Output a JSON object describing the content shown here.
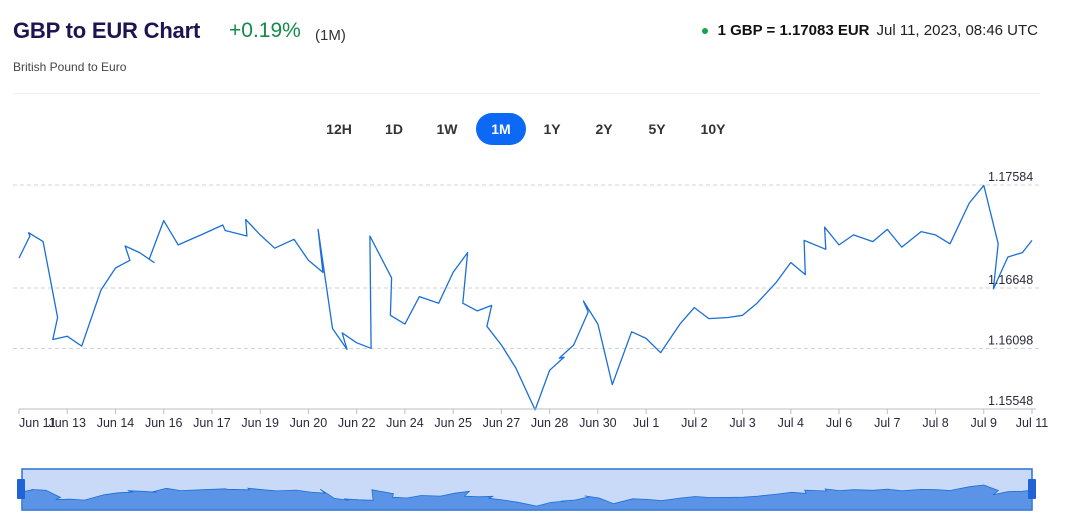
{
  "header": {
    "title": "GBP to EUR Chart",
    "change": "+0.19%",
    "period": "(1M)",
    "subtitle": "British Pound to Euro",
    "rate": "1 GBP = 1.17083 EUR",
    "timestamp": "Jul 11, 2023, 08:46 UTC"
  },
  "periods": {
    "buttons": [
      "12H",
      "1D",
      "1W",
      "1M",
      "1Y",
      "2Y",
      "5Y",
      "10Y"
    ],
    "active": "1M"
  },
  "colors": {
    "line": "#1b6fd6",
    "accent": "#0b69f6",
    "positive": "#138a4a",
    "navigator_fill": "#5b93e6",
    "navigator_bg": "#c8daf7"
  },
  "chart_data": {
    "type": "line",
    "x_tick_labels": [
      "Jun 11",
      "Jun 13",
      "Jun 14",
      "Jun 16",
      "Jun 17",
      "Jun 19",
      "Jun 20",
      "Jun 22",
      "Jun 24",
      "Jun 25",
      "Jun 27",
      "Jun 28",
      "Jun 30",
      "Jul 1",
      "Jul 2",
      "Jul 3",
      "Jul 4",
      "Jul 6",
      "Jul 7",
      "Jul 8",
      "Jul 9",
      "Jul 11"
    ],
    "y_ticks": [
      "1.17584",
      "1.16648",
      "1.16098",
      "1.15548"
    ],
    "ylim": [
      1.15548,
      1.17584
    ],
    "grid": "horizontal dashed",
    "navigator": true,
    "series": [
      {
        "x": [
          "Jun 11",
          "Jun 11",
          "Jun 12",
          "Jun 12",
          "Jun 12",
          "Jun 13",
          "Jun 13",
          "Jun 13",
          "Jun 14",
          "Jun 14",
          "Jun 14",
          "Jun 15",
          "Jun 15",
          "Jun 15",
          "Jun 16",
          "Jun 16",
          "Jun 16",
          "Jun 17",
          "Jun 17",
          "Jun 18",
          "Jun 18",
          "Jun 19",
          "Jun 19",
          "Jun 19",
          "Jun 20",
          "Jun 20",
          "Jun 20",
          "Jun 21",
          "Jun 21",
          "Jun 21",
          "Jun 22",
          "Jun 22",
          "Jun 22",
          "Jun 23",
          "Jun 23",
          "Jun 24",
          "Jun 24",
          "Jun 24",
          "Jun 25",
          "Jun 25",
          "Jun 25",
          "Jun 26",
          "Jun 26",
          "Jun 26",
          "Jun 27",
          "Jun 27",
          "Jun 27",
          "Jun 28",
          "Jun 28",
          "Jun 28",
          "Jun 29",
          "Jun 29",
          "Jun 29",
          "Jun 30",
          "Jun 30",
          "Jun 30",
          "Jul 1",
          "Jul 1",
          "Jul 1",
          "Jul 2",
          "Jul 2",
          "Jul 2",
          "Jul 3",
          "Jul 3",
          "Jul 3",
          "Jul 4",
          "Jul 4",
          "Jul 4",
          "Jul 5",
          "Jul 5",
          "Jul 6",
          "Jul 6",
          "Jul 6",
          "Jul 7",
          "Jul 7",
          "Jul 7",
          "Jul 8",
          "Jul 8",
          "Jul 8",
          "Jul 9",
          "Jul 9",
          "Jul 9",
          "Jul 10",
          "Jul 10",
          "Jul 10",
          "Jul 11"
        ],
        "y": [
          1.1692,
          1.1712,
          1.1715,
          1.1707,
          1.1638,
          1.1618,
          1.1621,
          1.1612,
          1.1663,
          1.1683,
          1.169,
          1.1703,
          1.1697,
          1.1688,
          1.1691,
          1.1726,
          1.1704,
          1.1713,
          1.1722,
          1.1717,
          1.1712,
          1.1727,
          1.1713,
          1.1701,
          1.1709,
          1.169,
          1.1679,
          1.1718,
          1.1628,
          1.1609,
          1.1624,
          1.1615,
          1.161,
          1.1712,
          1.1674,
          1.164,
          1.1632,
          1.1657,
          1.1651,
          1.1679,
          1.1697,
          1.1651,
          1.1644,
          1.1649,
          1.163,
          1.1613,
          1.1592,
          1.1554,
          1.159,
          1.1602,
          1.1601,
          1.1613,
          1.1643,
          1.1653,
          1.1632,
          1.1577,
          1.1625,
          1.1619,
          1.1606,
          1.1632,
          1.1647,
          1.1637,
          1.1638,
          1.164,
          1.1651,
          1.167,
          1.1688,
          1.1677,
          1.1708,
          1.17,
          1.172,
          1.1704,
          1.1713,
          1.1707,
          1.1718,
          1.1702,
          1.1716,
          1.1713,
          1.1705,
          1.1742,
          1.1758,
          1.1705,
          1.1664,
          1.1693,
          1.1697,
          1.1708
        ]
      }
    ]
  }
}
